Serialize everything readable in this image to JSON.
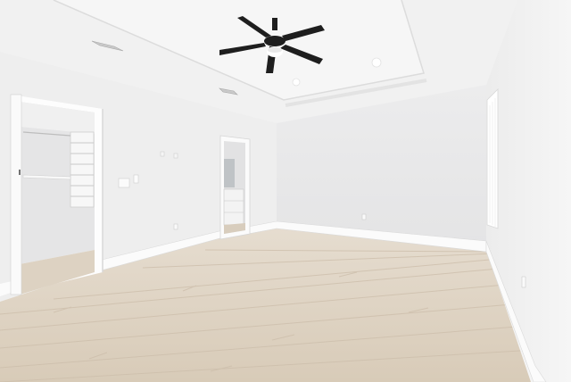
{
  "scene": {
    "subject": "empty-bedroom-interior",
    "watermark_text": "",
    "colors": {
      "ceiling": "#f2f2f2",
      "tray": "#f7f7f7",
      "wall_left": "#ededed",
      "wall_back": "#e9e9ea",
      "wall_right": "#f1f1f1",
      "floor": "#ddd2c2",
      "floor_plank_line": "#cfc2b0",
      "baseboard": "#fafafa",
      "fan": "#1f1f1f",
      "light": "#ffffff",
      "window": "#ffffff"
    }
  }
}
